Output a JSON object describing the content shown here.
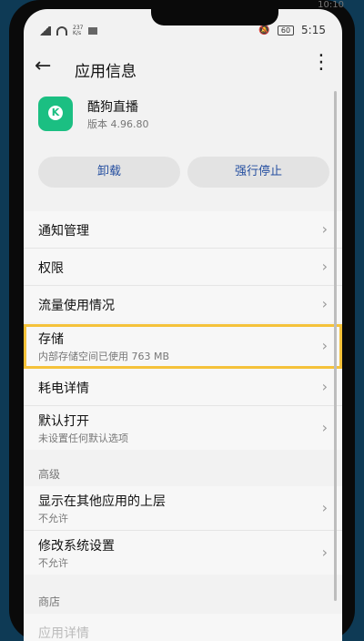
{
  "status": {
    "speed_top": "237",
    "speed_unit": "K/s",
    "battery": "60",
    "time": "5:15",
    "corner_time": "10:10"
  },
  "header": {
    "back_icon": "←",
    "title": "应用信息",
    "more_icon": "⋮"
  },
  "app": {
    "name": "酷狗直播",
    "version": "版本 4.96.80",
    "icon_letter": "K",
    "icon_color": "#1bbf82"
  },
  "buttons": {
    "uninstall": "卸载",
    "force_stop": "强行停止"
  },
  "group1": [
    {
      "label": "通知管理"
    },
    {
      "label": "权限"
    },
    {
      "label": "流量使用情况"
    }
  ],
  "group2": [
    {
      "label": "存储",
      "sub": "内部存储空间已使用 763 MB"
    },
    {
      "label": "耗电详情"
    },
    {
      "label": "默认打开",
      "sub": "未设置任何默认选项"
    }
  ],
  "advanced": {
    "title": "高级",
    "items": [
      {
        "label": "显示在其他应用的上层",
        "sub": "不允许"
      },
      {
        "label": "修改系统设置",
        "sub": "不允许"
      }
    ]
  },
  "store": {
    "title": "商店",
    "partial_item": "应用详情"
  },
  "chevron": "›",
  "accent": "#254fa0",
  "highlight_color": "#f5c23a"
}
